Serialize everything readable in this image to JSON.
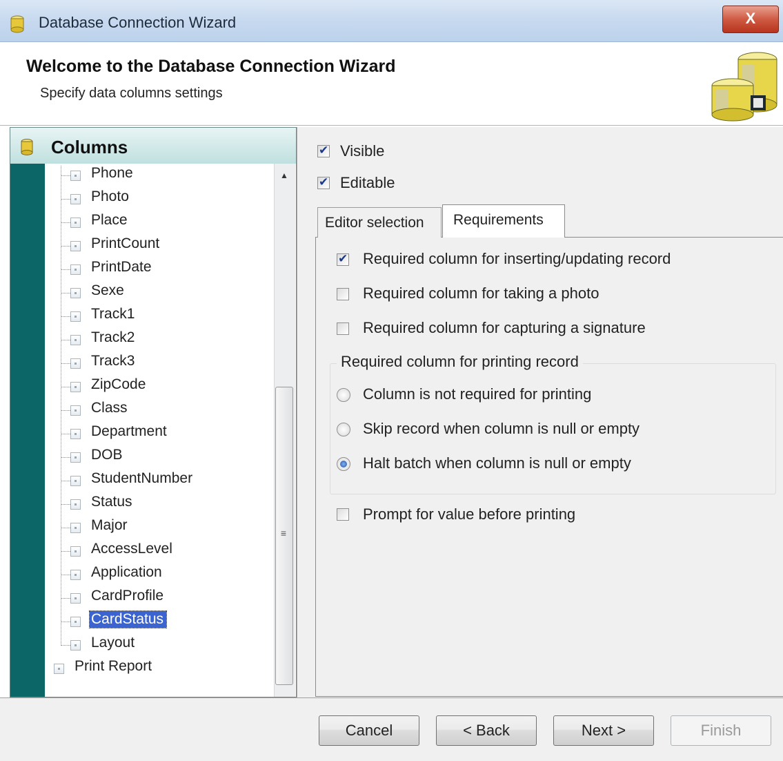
{
  "window": {
    "title": "Database Connection Wizard",
    "close_glyph": "X"
  },
  "header": {
    "title": "Welcome to the Database Connection Wizard",
    "subtitle": "Specify data columns settings"
  },
  "sidebar": {
    "title": "Columns",
    "items": [
      {
        "label": "Phone"
      },
      {
        "label": "Photo"
      },
      {
        "label": "Place"
      },
      {
        "label": "PrintCount"
      },
      {
        "label": "PrintDate"
      },
      {
        "label": "Sexe"
      },
      {
        "label": "Track1"
      },
      {
        "label": "Track2"
      },
      {
        "label": "Track3"
      },
      {
        "label": "ZipCode"
      },
      {
        "label": "Class"
      },
      {
        "label": "Department"
      },
      {
        "label": "DOB"
      },
      {
        "label": "StudentNumber"
      },
      {
        "label": "Status"
      },
      {
        "label": "Major"
      },
      {
        "label": "AccessLevel"
      },
      {
        "label": "Application"
      },
      {
        "label": "CardProfile"
      },
      {
        "label": "CardStatus",
        "selected": true
      },
      {
        "label": "Layout"
      }
    ],
    "root_item": "Print Report",
    "scroll_up_glyph": "▲",
    "scroll_grip_glyph": "≡"
  },
  "column_options": {
    "visible_label": "Visible",
    "visible_checked": true,
    "editable_label": "Editable",
    "editable_checked": true
  },
  "tabs": [
    {
      "label": "Editor selection",
      "active": false
    },
    {
      "label": "Requirements",
      "active": true
    }
  ],
  "requirements": {
    "insert_update_label": "Required column for inserting/updating record",
    "insert_update_checked": true,
    "photo_label": "Required column for taking a photo",
    "photo_checked": false,
    "signature_label": "Required column for capturing a signature",
    "signature_checked": false,
    "printing_group_title": "Required column for printing record",
    "printing_options": [
      {
        "label": "Column is not required for printing",
        "selected": false
      },
      {
        "label": "Skip record when column is null or empty",
        "selected": false
      },
      {
        "label": "Halt batch when column is null or empty",
        "selected": true
      }
    ],
    "prompt_label": "Prompt for value before printing",
    "prompt_checked": false
  },
  "buttons": {
    "cancel": "Cancel",
    "back": "< Back",
    "next": "Next >",
    "finish": "Finish",
    "finish_disabled": true
  },
  "colors": {
    "sidebar_strip": "#0c6566",
    "selection": "#3b64d0",
    "close_button": "#cf5a43"
  }
}
